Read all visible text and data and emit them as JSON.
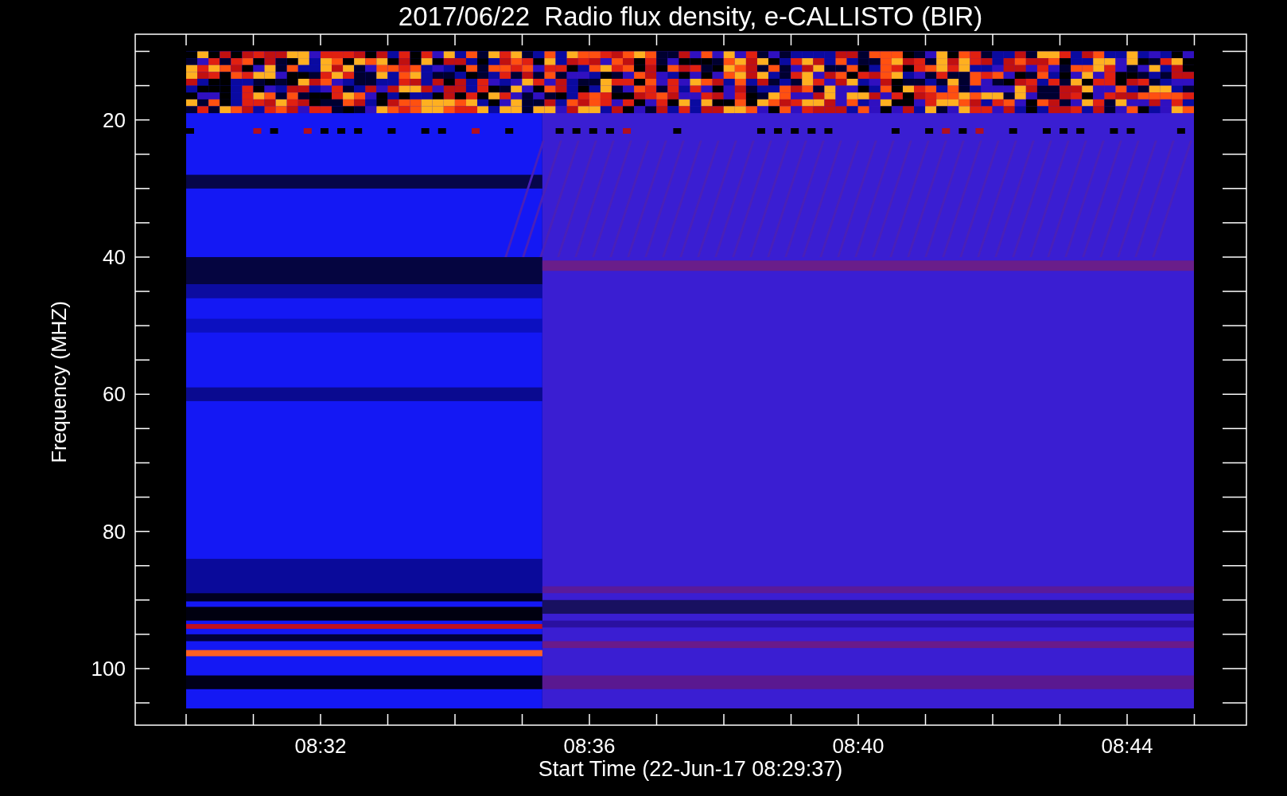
{
  "chart": {
    "title": "2017/06/22  Radio flux density, e-CALLISTO (BIR)",
    "ylabel": "Frequency (MHZ)",
    "xlabel": "Start Time (22-Jun-17 08:29:37)",
    "yticks": [
      "20",
      "40",
      "60",
      "80",
      "100"
    ],
    "xticks": [
      "08:32",
      "08:36",
      "08:40",
      "08:44"
    ]
  }
}
